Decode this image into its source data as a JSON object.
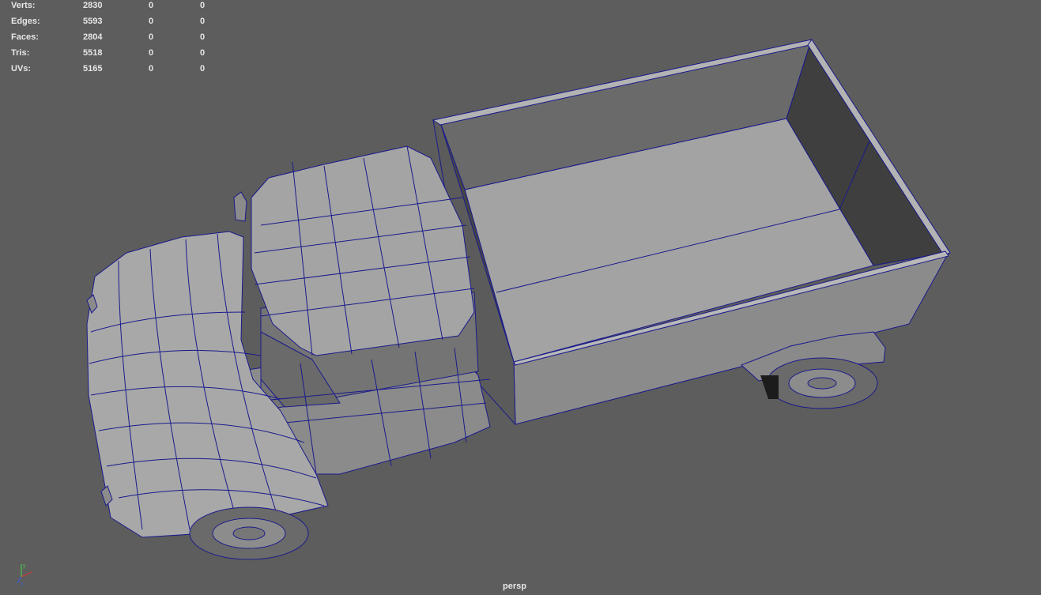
{
  "hud": {
    "rows": [
      {
        "label": "Verts:",
        "values": [
          "2830",
          "0",
          "0"
        ]
      },
      {
        "label": "Edges:",
        "values": [
          "5593",
          "0",
          "0"
        ]
      },
      {
        "label": "Faces:",
        "values": [
          "2804",
          "0",
          "0"
        ]
      },
      {
        "label": "Tris:",
        "values": [
          "5518",
          "0",
          "0"
        ]
      },
      {
        "label": "UVs:",
        "values": [
          "5165",
          "0",
          "0"
        ]
      }
    ]
  },
  "viewport": {
    "camera": "persp",
    "background_color": "#5d5d5d",
    "wire_color": "#1a1a8c"
  },
  "axis_gizmo": {
    "y_label": "y",
    "z_label": "z",
    "x_color": "#d33a3a",
    "y_color": "#4fc24f",
    "z_color": "#3a5fd3"
  }
}
